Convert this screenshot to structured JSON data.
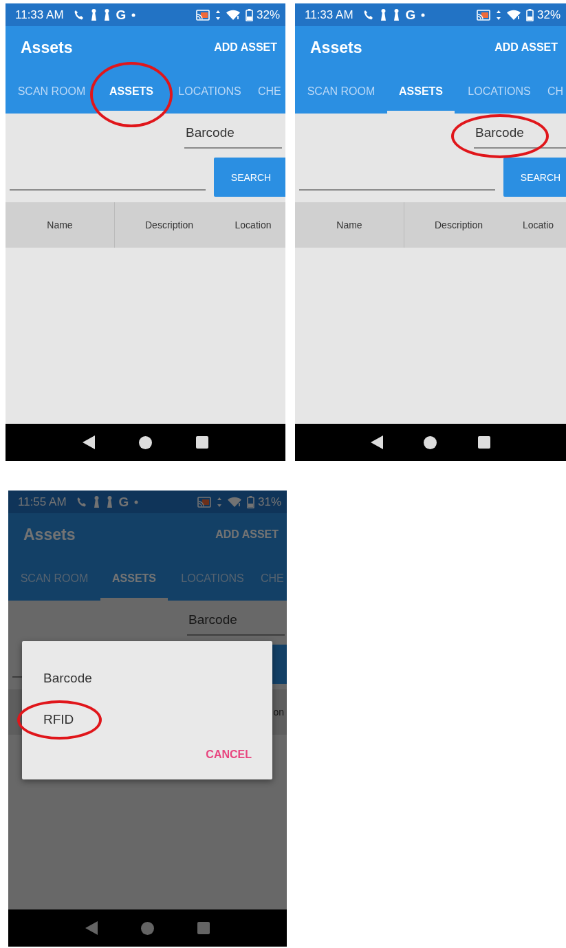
{
  "screens": [
    {
      "status_bar": {
        "time": "11:33 AM",
        "glyph": "G",
        "battery": "32%"
      },
      "app_bar": {
        "title": "Assets",
        "action": "ADD ASSET"
      },
      "tabs": [
        {
          "label": "SCAN ROOM",
          "selected": false,
          "circled": false
        },
        {
          "label": "ASSETS",
          "selected": true,
          "circled": true
        },
        {
          "label": "LOCATIONS",
          "selected": false,
          "circled": false
        },
        {
          "label": "CHE",
          "selected": false,
          "circled": false
        }
      ],
      "mode_field": {
        "value": "Barcode",
        "circled": false
      },
      "search_button": {
        "label": "SEARCH"
      },
      "table": {
        "columns": [
          "Name",
          "Description",
          "Location"
        ]
      }
    },
    {
      "status_bar": {
        "time": "11:33 AM",
        "glyph": "G",
        "battery": "32%"
      },
      "app_bar": {
        "title": "Assets",
        "action": "ADD ASSET"
      },
      "tabs": [
        {
          "label": "SCAN ROOM",
          "selected": false,
          "circled": false
        },
        {
          "label": "ASSETS",
          "selected": true,
          "circled": false
        },
        {
          "label": "LOCATIONS",
          "selected": false,
          "circled": false
        },
        {
          "label": "CH",
          "selected": false,
          "circled": false
        }
      ],
      "mode_field": {
        "value": "Barcode",
        "circled": true
      },
      "search_button": {
        "label": "SEARCH"
      },
      "table": {
        "columns": [
          "Name",
          "Description",
          "Locatio"
        ]
      }
    },
    {
      "status_bar": {
        "time": "11:55 AM",
        "glyph": "G",
        "battery": "31%"
      },
      "app_bar": {
        "title": "Assets",
        "action": "ADD ASSET"
      },
      "tabs": [
        {
          "label": "SCAN ROOM",
          "selected": false,
          "circled": false
        },
        {
          "label": "ASSETS",
          "selected": true,
          "circled": false
        },
        {
          "label": "LOCATIONS",
          "selected": false,
          "circled": false
        },
        {
          "label": "CHE",
          "selected": false,
          "circled": false
        }
      ],
      "mode_field": {
        "value": "Barcode",
        "circled": false
      },
      "table": {
        "columns": [
          "on"
        ]
      },
      "dialog": {
        "options": [
          {
            "label": "Barcode",
            "circled": false
          },
          {
            "label": "RFID",
            "circled": true
          }
        ],
        "cancel": "CANCEL"
      }
    }
  ]
}
